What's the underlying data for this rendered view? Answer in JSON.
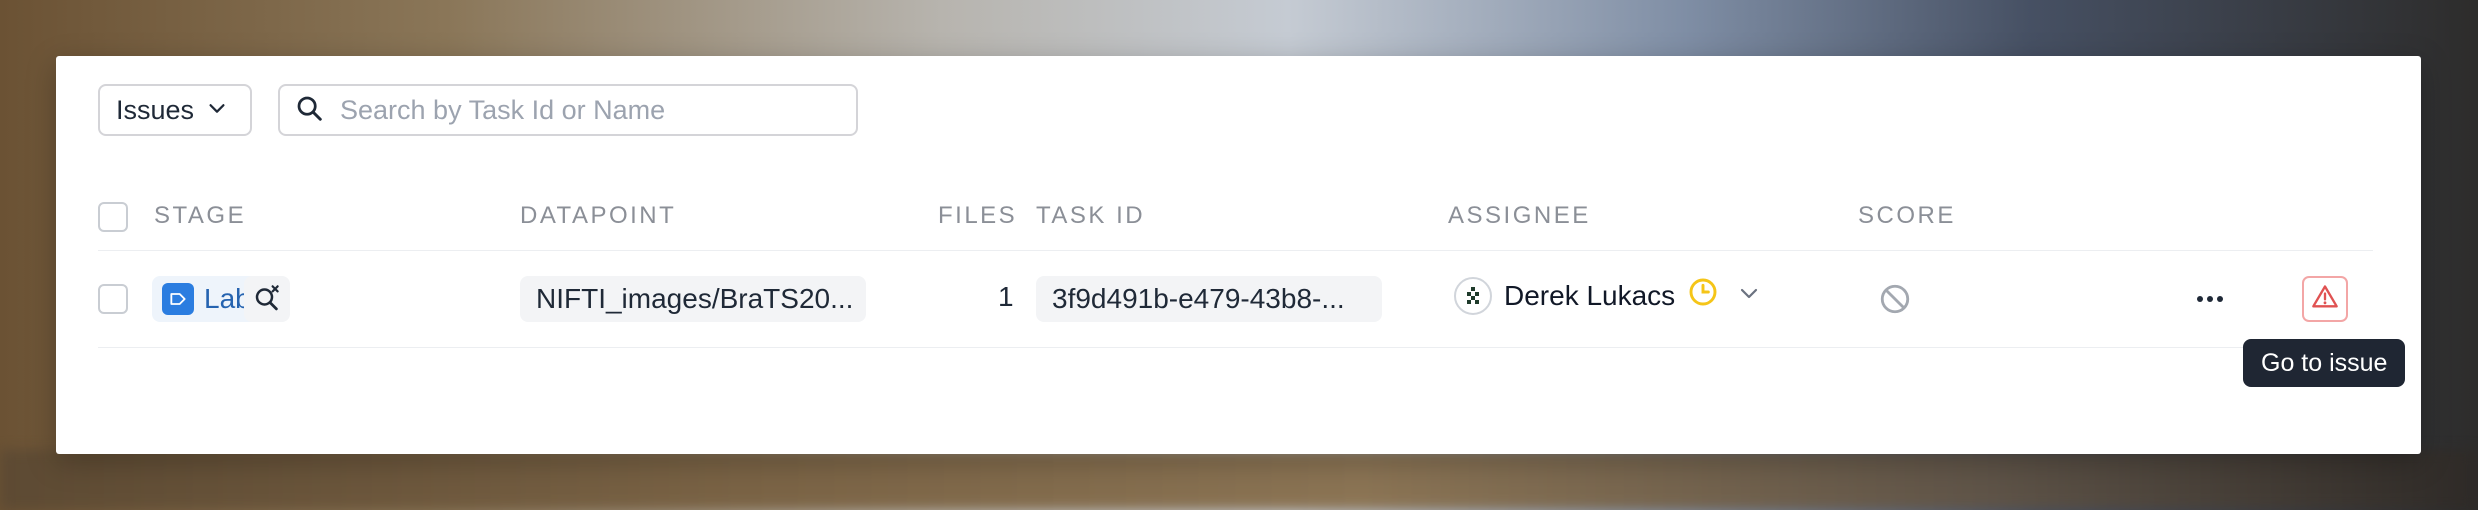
{
  "toolbar": {
    "filter_dropdown_value": "Issues",
    "search_placeholder": "Search by Task Id or Name"
  },
  "table": {
    "columns": {
      "stage": "STAGE",
      "datapoint": "DATAPOINT",
      "files": "FILES",
      "task_id": "TASK ID",
      "assignee": "ASSIGNEE",
      "score": "SCORE"
    },
    "rows": [
      {
        "stage": "Label",
        "datapoint": "NIFTI_images/BraTS20...",
        "files": "1",
        "task_id": "3f9d491b-e479-43b8-...",
        "assignee": "Derek Lukacs"
      }
    ]
  },
  "tooltip": {
    "text": "Go to issue"
  },
  "colors": {
    "stage_accent": "#2b7de0",
    "issue_red": "#e05252",
    "status_yellow": "#f5c518",
    "tooltip_bg": "#1f2633"
  },
  "icons": {
    "dropdown_caret": "chevron-down-icon",
    "search": "search-icon",
    "stage": "label-tag-icon",
    "review": "search-close-icon",
    "assignee_status": "clock-status-icon",
    "score": "no-score-icon",
    "more": "more-horizontal-icon",
    "issue": "warning-triangle-icon"
  }
}
